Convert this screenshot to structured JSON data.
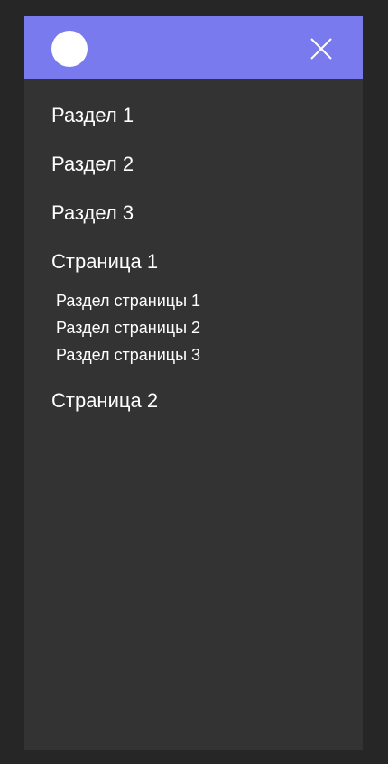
{
  "header": {
    "bg_color": "#7a7aef",
    "logo_icon": "circle-logo",
    "close_icon": "close-icon"
  },
  "nav": {
    "items": [
      {
        "label": "Раздел 1"
      },
      {
        "label": "Раздел 2"
      },
      {
        "label": "Раздел 3"
      },
      {
        "label": "Страница 1"
      },
      {
        "label": "Страница 2"
      }
    ],
    "page1_subitems": [
      {
        "label": "Раздел страницы 1"
      },
      {
        "label": "Раздел страницы 2"
      },
      {
        "label": "Раздел страницы 3"
      }
    ]
  },
  "colors": {
    "page_bg": "#262626",
    "panel_bg": "#333333",
    "text": "#ffffff"
  }
}
